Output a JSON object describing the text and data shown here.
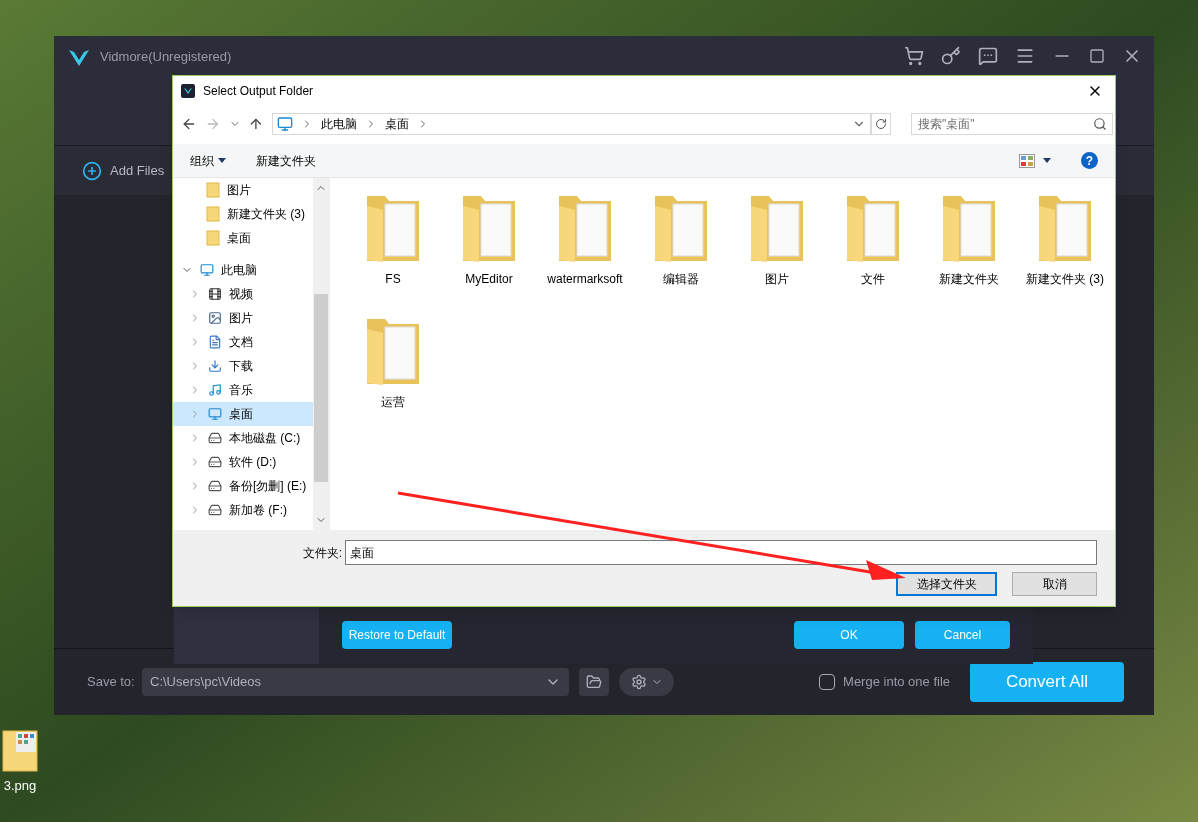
{
  "app": {
    "title": "Vidmore(Unregistered)",
    "add_files": "Add Files",
    "save_to": {
      "label": "Save to:",
      "value": "C:\\Users\\pc\\Videos"
    },
    "merge": {
      "label": "Merge into one file",
      "checked": false
    },
    "convert_all": "Convert All"
  },
  "settings_panel": {
    "restore": "Restore to Default",
    "ok": "OK",
    "cancel": "Cancel"
  },
  "dialog": {
    "title": "Select Output Folder",
    "breadcrumb": [
      "此电脑",
      "桌面"
    ],
    "search": {
      "placeholder": "搜索\"桌面\""
    },
    "toolbar": {
      "organize": "组织",
      "new_folder": "新建文件夹",
      "help": "?"
    },
    "nav": [
      {
        "label": "图片",
        "kind": "folder",
        "selected": false
      },
      {
        "label": "新建文件夹 (3)",
        "kind": "folder",
        "selected": false
      },
      {
        "label": "桌面",
        "kind": "folder",
        "selected": false
      },
      {
        "label": "此电脑",
        "kind": "pc",
        "selected": false,
        "expanded": true,
        "children": [
          {
            "label": "视频",
            "kind": "video",
            "selected": false,
            "expanded": false
          },
          {
            "label": "图片",
            "kind": "picture",
            "selected": false,
            "expanded": false
          },
          {
            "label": "文档",
            "kind": "doc",
            "selected": false,
            "expanded": false
          },
          {
            "label": "下载",
            "kind": "download",
            "selected": false,
            "expanded": false
          },
          {
            "label": "音乐",
            "kind": "music",
            "selected": false,
            "expanded": false
          },
          {
            "label": "桌面",
            "kind": "desktop",
            "selected": true,
            "expanded": false
          },
          {
            "label": "本地磁盘 (C:)",
            "kind": "sysdrive",
            "selected": false,
            "expanded": false
          },
          {
            "label": "软件 (D:)",
            "kind": "drive",
            "selected": false,
            "expanded": false
          },
          {
            "label": "备份[勿删] (E:)",
            "kind": "drive",
            "selected": false,
            "expanded": false
          },
          {
            "label": "新加卷 (F:)",
            "kind": "drive",
            "selected": false,
            "expanded": false
          }
        ]
      }
    ],
    "folders": [
      {
        "name": "FS"
      },
      {
        "name": "MyEditor"
      },
      {
        "name": "watermarksoft"
      },
      {
        "name": "编辑器"
      },
      {
        "name": "图片"
      },
      {
        "name": "文件"
      },
      {
        "name": "新建文件夹"
      },
      {
        "name": "新建文件夹 (3)"
      },
      {
        "name": "运营"
      }
    ],
    "folder_field": {
      "label": "文件夹:",
      "value": "桌面"
    },
    "buttons": [
      {
        "label": "选择文件夹",
        "default": true
      },
      {
        "label": "取消",
        "default": false
      }
    ]
  },
  "desktop_icons": [
    {
      "label": "3.png"
    }
  ]
}
